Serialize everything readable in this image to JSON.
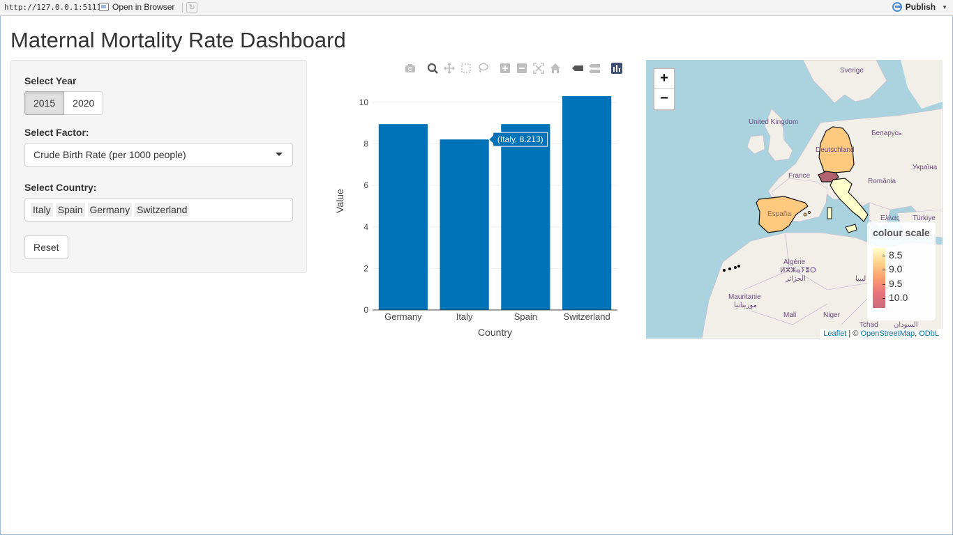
{
  "viewer": {
    "url": "http://127.0.0.1:5111",
    "open_in_browser": "Open in Browser",
    "publish": "Publish"
  },
  "page": {
    "title": "Maternal Mortality Rate Dashboard"
  },
  "sidebar": {
    "year_label": "Select Year",
    "years": [
      "2015",
      "2020"
    ],
    "selected_year": "2015",
    "factor_label": "Select Factor:",
    "factor_value": "Crude Birth Rate (per 1000 people)",
    "country_label": "Select Country:",
    "countries": [
      "Italy",
      "Spain",
      "Germany",
      "Switzerland"
    ],
    "reset_label": "Reset"
  },
  "chart_data": {
    "type": "bar",
    "categories": [
      "Germany",
      "Italy",
      "Spain",
      "Switzerland"
    ],
    "values": [
      8.95,
      8.213,
      8.95,
      10.3
    ],
    "xlabel": "Country",
    "ylabel": "Value",
    "ylim": [
      0,
      10.5
    ],
    "yticks": [
      0,
      2,
      4,
      6,
      8,
      10
    ],
    "bar_color": "#0072b8",
    "grid": true,
    "hover_label": "(Italy, 8.213)"
  },
  "map": {
    "zoom_in": "+",
    "zoom_out": "−",
    "labels": {
      "sverige": "Sverige",
      "uk": "United Kingdom",
      "belarus": "Беларусь",
      "deutschland": "Deutschland",
      "ukraina": "Україна",
      "france": "France",
      "romania": "România",
      "espana": "España",
      "ellas": "Ελλάς",
      "turkiye": "Türkiye",
      "algerie": "Algérie",
      "algerie_tif": "ⵍⵣⵣⴰⵢⴻⵔ",
      "algerie_ar": "الجزائر",
      "libya": "ليبيا",
      "mauritanie": "Mauritanie",
      "mauritanie_ar": "موريتانيا",
      "mali": "Mali",
      "niger": "Niger",
      "tchad": "Tchad",
      "sudan": "السودان"
    },
    "legend_title": "colour scale",
    "legend_ticks": [
      "8.5",
      "9.0",
      "9.5",
      "10.0"
    ],
    "attribution_leaflet": "Leaflet",
    "attribution_sep": " | © ",
    "attribution_osm": "OpenStreetMap",
    "attribution_comma": ", ",
    "attribution_odbl": "ODbL",
    "colors": {
      "sea": "#aad3df",
      "land": "#f2efe9",
      "germany": "#fdc97f",
      "spain": "#fdc97f",
      "italy": "#ffffcc",
      "switzerland": "#b0636e"
    }
  }
}
